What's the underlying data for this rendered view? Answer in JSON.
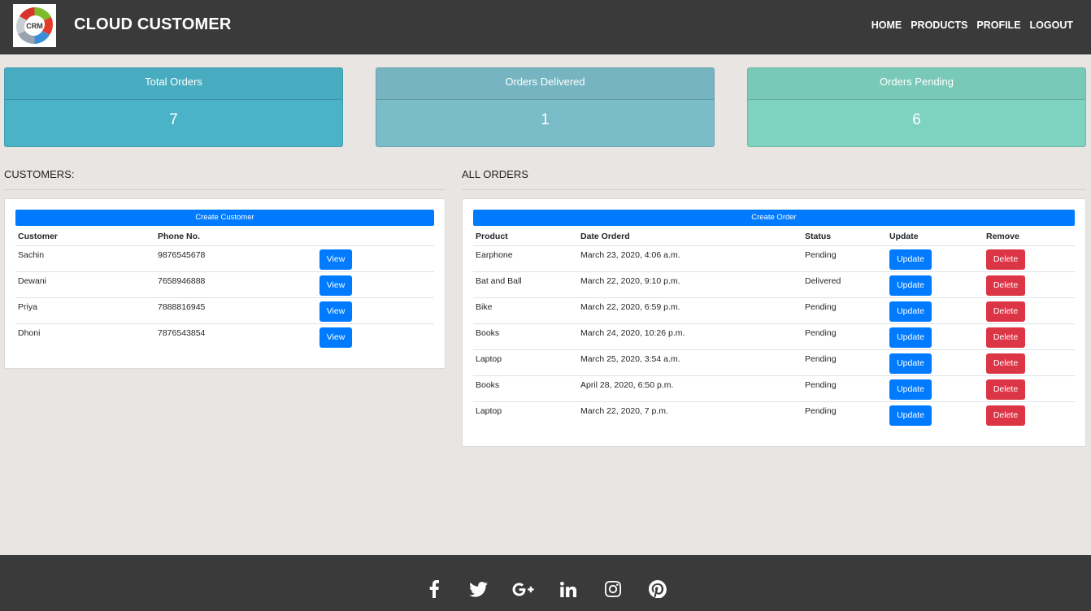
{
  "header": {
    "logo_text": "CRM",
    "brand": "CLOUD CUSTOMER",
    "nav": [
      "HOME",
      "PRODUCTS",
      "PROFILE",
      "LOGOUT"
    ]
  },
  "stats": {
    "total": {
      "label": "Total Orders",
      "value": "7"
    },
    "delivered": {
      "label": "Orders Delivered",
      "value": "1"
    },
    "pending": {
      "label": "Orders Pending",
      "value": "6"
    }
  },
  "customers": {
    "title": "CUSTOMERS:",
    "create_label": "Create Customer",
    "columns": [
      "Customer",
      "Phone No.",
      ""
    ],
    "view_label": "View",
    "rows": [
      {
        "name": "Sachin",
        "phone": "9876545678"
      },
      {
        "name": "Dewani",
        "phone": "7658946888"
      },
      {
        "name": "Priya",
        "phone": "7888816945"
      },
      {
        "name": "Dhoni",
        "phone": "7876543854"
      }
    ]
  },
  "orders": {
    "title": "ALL ORDERS",
    "create_label": "Create Order",
    "columns": [
      "Product",
      "Date Orderd",
      "Status",
      "Update",
      "Remove"
    ],
    "update_label": "Update",
    "delete_label": "Delete",
    "rows": [
      {
        "product": "Earphone",
        "date": "March 23, 2020, 4:06 a.m.",
        "status": "Pending"
      },
      {
        "product": "Bat and Ball",
        "date": "March 22, 2020, 9:10 p.m.",
        "status": "Delivered"
      },
      {
        "product": "Bike",
        "date": "March 22, 2020, 6:59 p.m.",
        "status": "Pending"
      },
      {
        "product": "Books",
        "date": "March 24, 2020, 10:26 p.m.",
        "status": "Pending"
      },
      {
        "product": "Laptop",
        "date": "March 25, 2020, 3:54 a.m.",
        "status": "Pending"
      },
      {
        "product": "Books",
        "date": "April 28, 2020, 6:50 p.m.",
        "status": "Pending"
      },
      {
        "product": "Laptop",
        "date": "March 22, 2020, 7 p.m.",
        "status": "Pending"
      }
    ]
  },
  "footer": {
    "social_icons": [
      "facebook-icon",
      "twitter-icon",
      "google-plus-icon",
      "linkedin-icon",
      "instagram-icon",
      "pinterest-icon"
    ]
  },
  "colors": {
    "navbar": "#3a3a3a",
    "background": "#e9e5e3",
    "primary": "#007bff",
    "danger": "#dc3545",
    "card_total": "#4ab3c7",
    "card_delivered": "#7abcc8",
    "card_pending": "#7ed2c0"
  }
}
